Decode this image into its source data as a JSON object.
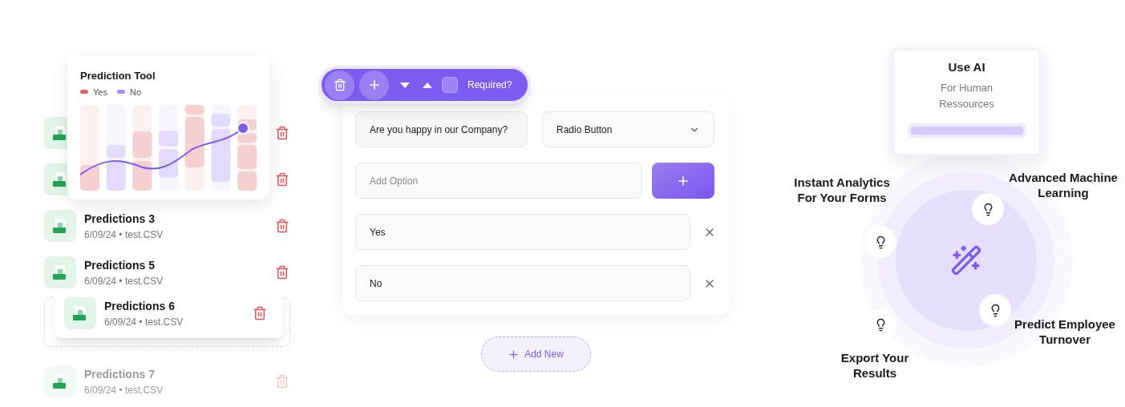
{
  "prediction_tool": {
    "title": "Prediction Tool",
    "legend": [
      {
        "label": "Yes",
        "color": "#e06666"
      },
      {
        "label": "No",
        "color": "#a78bfa"
      }
    ]
  },
  "predictions": [
    {
      "kind": "covered"
    },
    {
      "kind": "covered"
    },
    {
      "kind": "normal",
      "title": "Predictions 3",
      "meta": "6/09/24 • test.CSV"
    },
    {
      "kind": "normal",
      "title": "Predictions 5",
      "meta": "6/09/24 • test.CSV"
    },
    {
      "kind": "dragging",
      "title": "Predictions 6",
      "meta": "6/09/24 • test.CSV"
    },
    {
      "kind": "faded",
      "title": "Predictions 7",
      "meta": "6/09/24 • test.CSV"
    }
  ],
  "toolbar": {
    "required_label": "Required?",
    "required_checked": false
  },
  "form": {
    "question": "Are you happy in our Company?",
    "answer_type": "Radio Button",
    "add_option_placeholder": "Add Option",
    "options": [
      "Yes",
      "No"
    ],
    "add_new": "Add New"
  },
  "ai_card": {
    "title": "Use AI",
    "subtitle": "For Human Ressources"
  },
  "features": [
    "Instant Analytics For Your Forms",
    "Advanced Machine Learning",
    "Predict Employee Turnover",
    "Export Your Results"
  ]
}
